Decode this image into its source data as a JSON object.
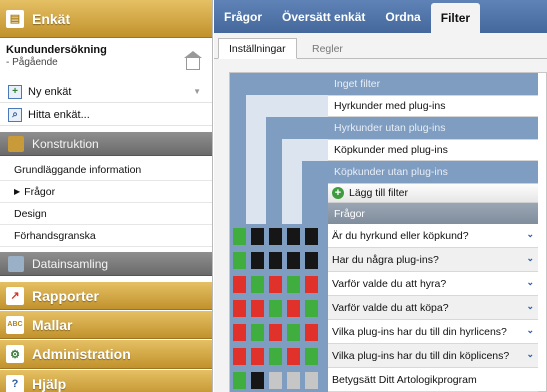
{
  "sidebar": {
    "header_title": "Enkät",
    "project_name": "Kundundersökning",
    "project_status": "- Pågående",
    "new_survey": "Ny enkät",
    "find_survey": "Hitta enkät...",
    "construction_title": "Konstruktion",
    "construction_items": [
      "Grundläggande information",
      "Frågor",
      "Design",
      "Förhandsgranska"
    ],
    "active_construction_item": "Frågor",
    "data_collection_title": "Datainsamling",
    "sections": [
      "Rapporter",
      "Mallar",
      "Administration",
      "Hjälp"
    ]
  },
  "topnav": {
    "tabs": [
      "Frågor",
      "Översätt enkät",
      "Ordna",
      "Filter"
    ],
    "active_tab": "Filter"
  },
  "subtabs": {
    "items": [
      "Inställningar",
      "Regler"
    ],
    "active": "Inställningar"
  },
  "filters": {
    "items": [
      "Inget filter",
      "Hyrkunder med plug-ins",
      "Hyrkunder utan plug-ins",
      "Köpkunder med plug-ins",
      "Köpkunder utan plug-ins"
    ],
    "add_filter_label": "Lägg till filter"
  },
  "questions": {
    "header": "Frågor",
    "items": [
      "Är du hyrkund eller köpkund?",
      "Har du några plug-ins?",
      "Varför valde du att hyra?",
      "Varför valde du att köpa?",
      "Vilka plug-ins har du till din hyrlicens?",
      "Vilka plug-ins har du till din köplicens?",
      "Betygsätt Ditt Artologikprogram"
    ],
    "has_dropdown": [
      true,
      true,
      true,
      true,
      true,
      true,
      false
    ]
  },
  "matrix": {
    "legend": {
      "g": "green",
      "k": "black",
      "r": "red",
      "s": "gray"
    },
    "rows": [
      [
        "g",
        "k",
        "k",
        "k",
        "k"
      ],
      [
        "g",
        "k",
        "k",
        "k",
        "k"
      ],
      [
        "r",
        "g",
        "r",
        "g",
        "r"
      ],
      [
        "r",
        "r",
        "g",
        "r",
        "g"
      ],
      [
        "r",
        "g",
        "r",
        "g",
        "r"
      ],
      [
        "r",
        "r",
        "g",
        "r",
        "g"
      ],
      [
        "g",
        "k",
        "s",
        "s",
        "s"
      ]
    ]
  },
  "colors": {
    "gold_section": "#d4a646",
    "gray_section": "#7a7a7a",
    "topnav_blue": "#5277ad",
    "filter_blue": "#7f9cc1",
    "cell_green": "#3fae3f",
    "cell_red": "#e0322a",
    "cell_black": "#161616",
    "cell_gray": "#c6c6c6"
  },
  "icons": {
    "survey": "survey-icon",
    "home": "home-icon",
    "new": "new-survey-icon",
    "find": "search-icon",
    "construction": "construction-icon",
    "data": "data-collection-icon",
    "reports": "chart-icon",
    "templates": "template-icon",
    "admin": "gear-icon",
    "help": "help-icon",
    "add": "plus-icon",
    "dropdown": "chevron-down-icon"
  }
}
